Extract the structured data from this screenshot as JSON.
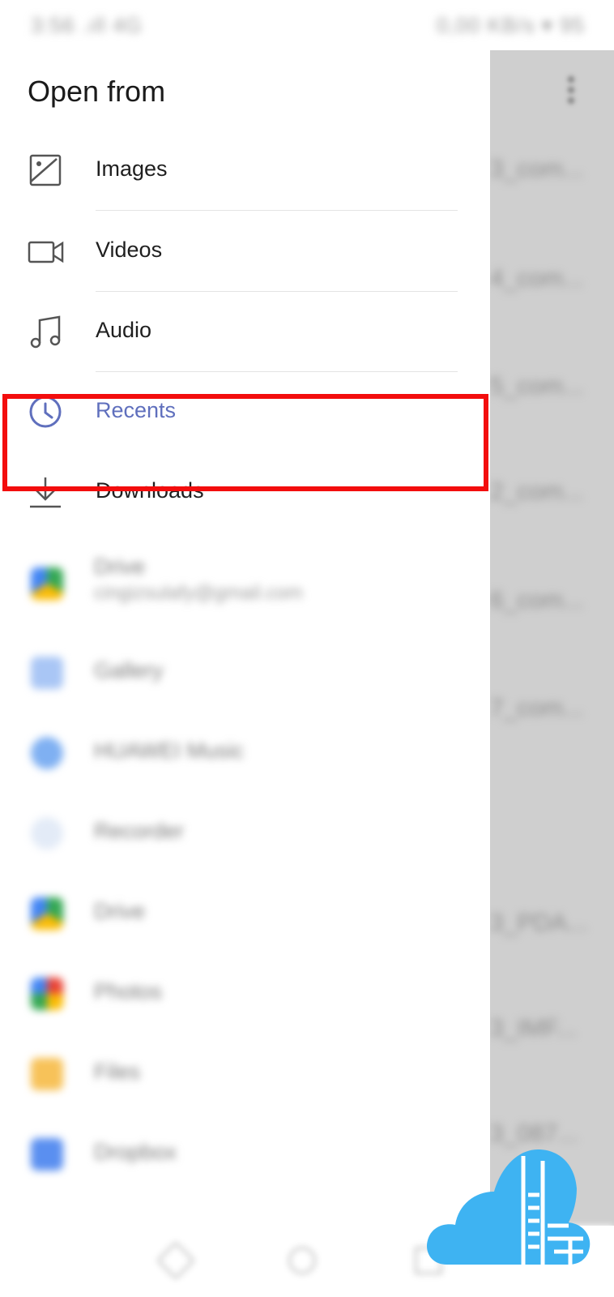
{
  "status_bar": {
    "left_text": "3:56 .ıll 4G",
    "right_text": "0,00 KB/s ▾ 95"
  },
  "drawer": {
    "title": "Open from",
    "items": [
      {
        "label": "Images",
        "icon": "image-icon"
      },
      {
        "label": "Videos",
        "icon": "video-icon"
      },
      {
        "label": "Audio",
        "icon": "music-note-icon"
      },
      {
        "label": "Recents",
        "icon": "clock-icon",
        "active": true
      },
      {
        "label": "Downloads",
        "icon": "download-icon",
        "highlighted": true
      }
    ],
    "apps": [
      {
        "label": "Drive",
        "sub": "cingizsulafy@gmail.com",
        "icon": "google-drive-icon"
      },
      {
        "label": "Gallery",
        "icon": "gallery-icon"
      },
      {
        "label": "HUAWEI Music",
        "icon": "huawei-music-icon"
      },
      {
        "label": "Recorder",
        "icon": "recorder-icon"
      },
      {
        "label": "Drive",
        "icon": "google-drive-icon"
      },
      {
        "label": "Photos",
        "icon": "google-photos-icon"
      },
      {
        "label": "Files",
        "icon": "files-icon"
      },
      {
        "label": "Dropbox",
        "icon": "dropbox-icon"
      }
    ]
  },
  "background_list": {
    "rows": [
      "3_com...",
      "4_com...",
      "5_com...",
      "2_com...",
      "6_com...",
      "7_com...",
      "3_PDA...",
      "3_IMF...",
      "3_087..."
    ]
  },
  "colors": {
    "active_item": "#5f6fbd",
    "highlight_border": "#f30d0d",
    "logo": "#3eb3f2"
  }
}
